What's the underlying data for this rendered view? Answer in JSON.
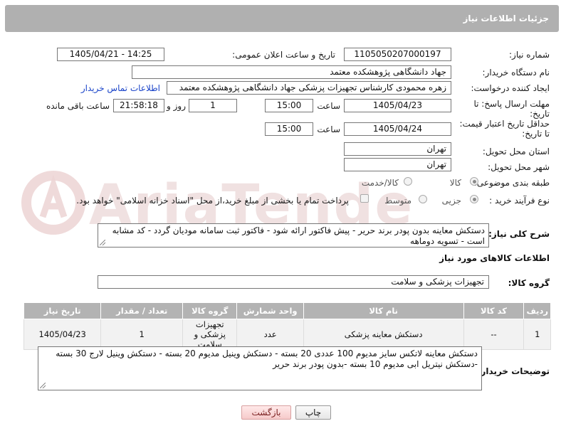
{
  "header": {
    "title": "جزئیات اطلاعات نیاز"
  },
  "fields": {
    "need_number_label": "شماره نیاز:",
    "need_number": "1105050207000197",
    "announce_label": "تاریخ و ساعت اعلان عمومی:",
    "announce_value": "1405/04/21 - 14:25",
    "buyer_org_label": "نام دستگاه خریدار:",
    "buyer_org": "جهاد دانشگاهی پژوهشکده معتمد",
    "requester_label": "ایجاد کننده درخواست:",
    "requester": "زهره محمودی کارشناس تجهیزات پزشکی جهاد دانشگاهی پژوهشکده معتمد",
    "contact_link": "اطلاعات تماس خریدار",
    "deadline_label_1": "مهلت ارسال پاسخ: تا",
    "deadline_label_2": "تاریخ:",
    "deadline_date": "1405/04/23",
    "time_label": "ساعت",
    "deadline_time": "15:00",
    "days_value": "1",
    "days_label": "روز و",
    "remaining_time": "21:58:18",
    "remaining_label": "ساعت باقی مانده",
    "validity_label_1": "حداقل تاریخ اعتبار قیمت:",
    "validity_label_2": "تا تاریخ:",
    "validity_date": "1405/04/24",
    "validity_time": "15:00",
    "province_label": "استان محل تحویل:",
    "province": "تهران",
    "city_label": "شهر محل تحویل:",
    "city": "تهران",
    "category_label": "طبقه بندی موضوعی:",
    "category_goods": "کالا",
    "category_service": "کالا/خدمت",
    "process_label": "نوع فرآیند خرید :",
    "process_partial": "جزیی",
    "process_medium": "متوسط",
    "payment_note": "پرداخت تمام یا بخشی از مبلغ خرید،از محل \"اسناد خزانه اسلامی\" خواهد بود."
  },
  "description": {
    "label": "شرح کلی نیاز:",
    "text": "دستکش معاینه بدون پودر  برند حریر - پیش فاکتور ارائه شود - فاکتور ثبت سامانه مودیان گردد - کد مشابه است - تسویه دوماهه"
  },
  "goods": {
    "section_title": "اطلاعات کالاهای مورد نیاز",
    "group_label": "گروه کالا:",
    "group_value": "تجهیزات پزشکی و سلامت",
    "columns": [
      "ردیف",
      "کد کالا",
      "نام کالا",
      "واحد شمارش",
      "گروه کالا",
      "تعداد / مقدار",
      "تاریخ نیاز"
    ],
    "rows": [
      {
        "row": "1",
        "code": "--",
        "name": "دستکش معاینه پزشکی",
        "unit": "عدد",
        "group": "تجهیزات پزشکی و سلامت",
        "qty": "1",
        "date": "1405/04/23"
      }
    ]
  },
  "buyer_notes": {
    "label": "توضیحات خریدار:",
    "text": "دستکش معاینه لاتکس سایز مدیوم 100 عددی 20 بسته - دستکش وینیل مدیوم 20 بسته - دستکش وینیل لارج 30 بسته -دستکش نیتریل ابی مدیوم 10 بسته -بدون پودر برند حریر"
  },
  "buttons": {
    "print": "چاپ",
    "back": "بازگشت"
  },
  "colors": {
    "header_bg": "#b0b0b0",
    "link": "#1a44c9",
    "watermark": "#e6c9c9"
  }
}
